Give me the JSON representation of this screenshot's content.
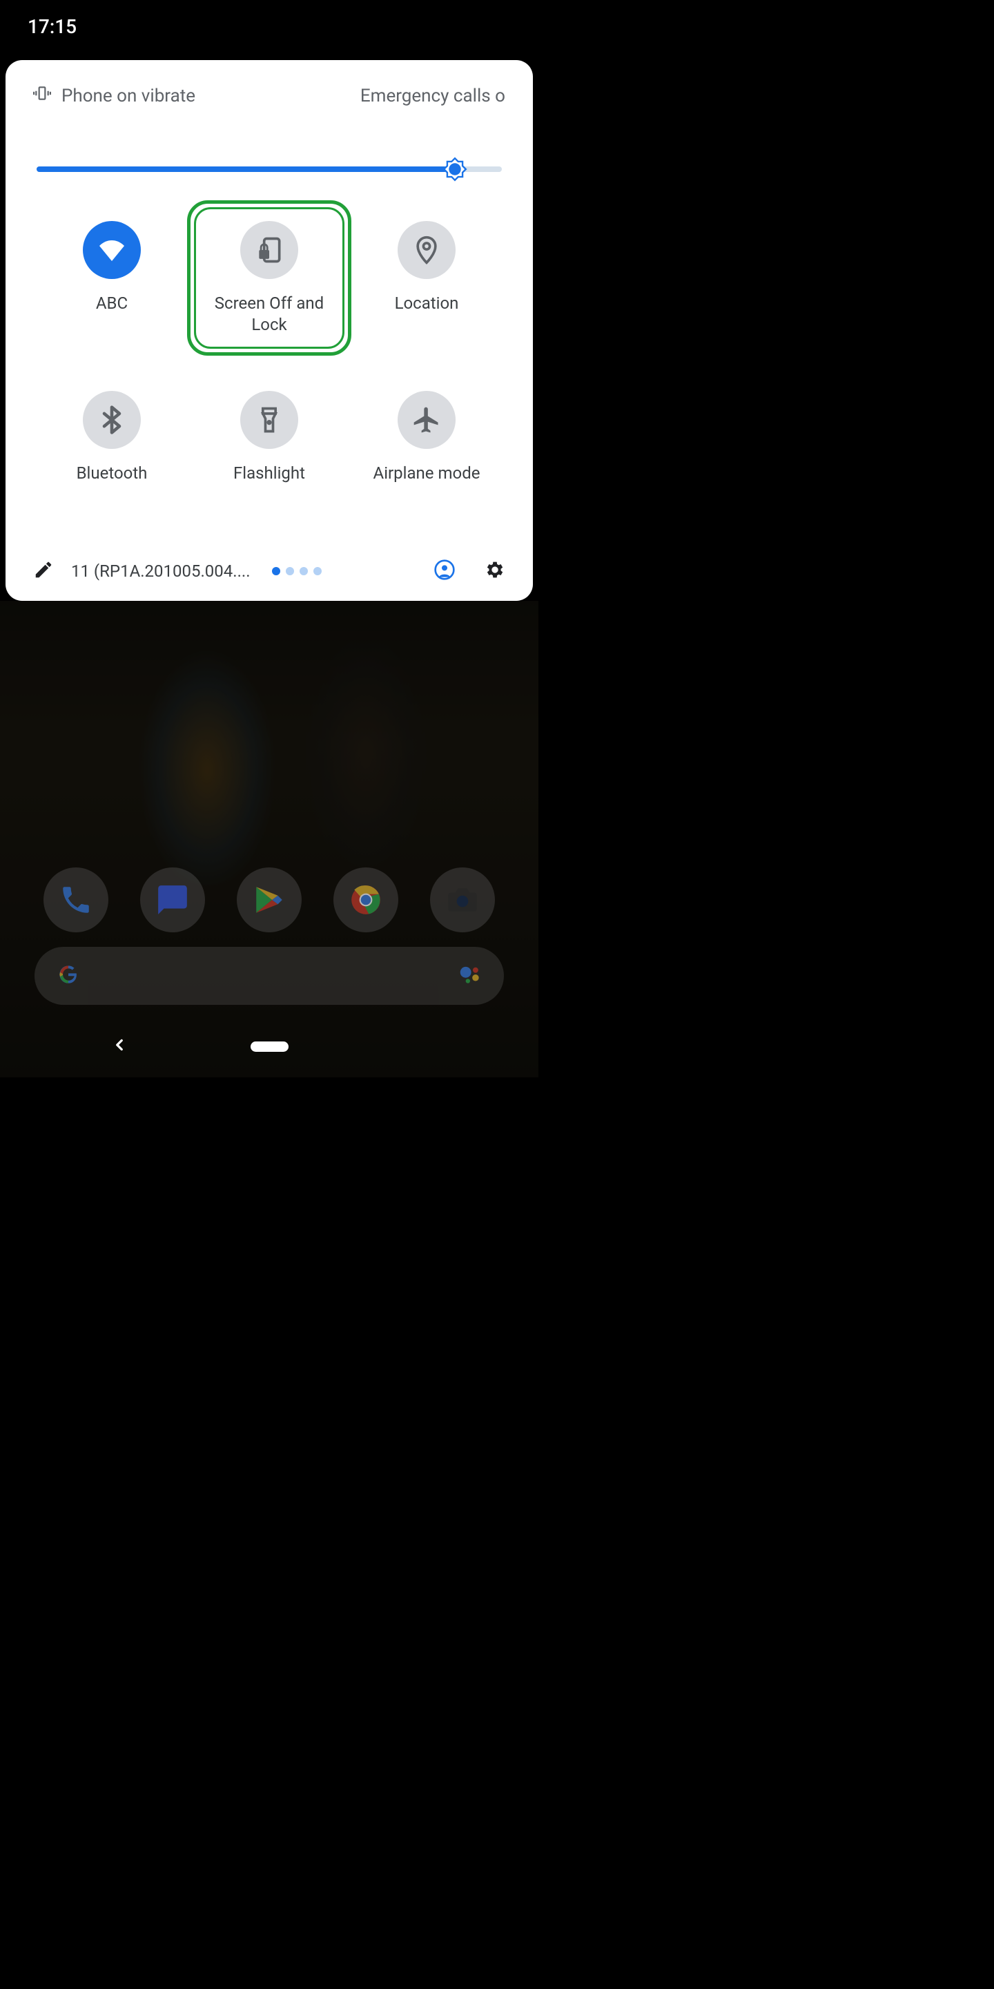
{
  "status_bar": {
    "time": "17:15"
  },
  "qs_header": {
    "vibrate_label": "Phone on vibrate",
    "emergency_label": "Emergency calls o"
  },
  "brightness": {
    "percent": 87
  },
  "tiles": [
    {
      "label": "ABC",
      "active": true,
      "icon": "wifi"
    },
    {
      "label": "Screen Off and Lock",
      "active": false,
      "icon": "screen-lock",
      "highlighted": true
    },
    {
      "label": "Location",
      "active": false,
      "icon": "location"
    },
    {
      "label": "Bluetooth",
      "active": false,
      "icon": "bluetooth"
    },
    {
      "label": "Flashlight",
      "active": false,
      "icon": "flashlight"
    },
    {
      "label": "Airplane mode",
      "active": false,
      "icon": "airplane"
    }
  ],
  "footer": {
    "build": "11 (RP1A.201005.004....",
    "pages": {
      "current": 0,
      "total": 4
    }
  },
  "colors": {
    "accent": "#1a73e8",
    "highlight": "#21a038",
    "tile_inactive_bg": "#dadce0",
    "tile_icon_inactive": "#5f6368"
  }
}
